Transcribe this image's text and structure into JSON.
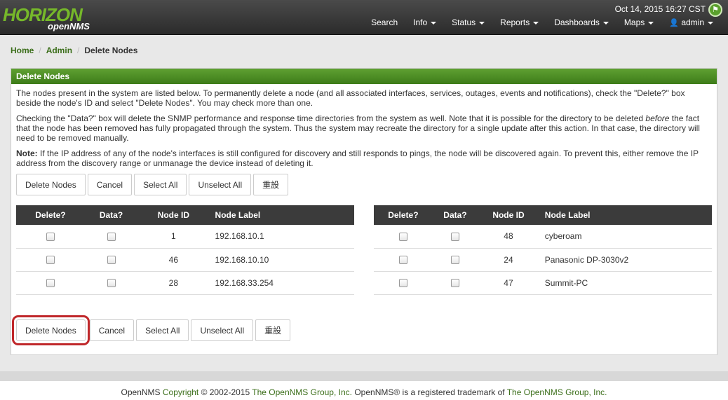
{
  "header": {
    "logo_horizon": "HORIZON",
    "logo_opennms": "openNMS",
    "datetime": "Oct 14, 2015 16:27 CST",
    "nav": [
      {
        "label": "Search",
        "dropdown": false
      },
      {
        "label": "Info",
        "dropdown": true
      },
      {
        "label": "Status",
        "dropdown": true
      },
      {
        "label": "Reports",
        "dropdown": true
      },
      {
        "label": "Dashboards",
        "dropdown": true
      },
      {
        "label": "Maps",
        "dropdown": true
      },
      {
        "label": "admin",
        "dropdown": true,
        "icon": "user-icon"
      }
    ]
  },
  "breadcrumb": {
    "home": "Home",
    "admin": "Admin",
    "current": "Delete Nodes"
  },
  "panel": {
    "title": "Delete Nodes",
    "p1": "The nodes present in the system are listed below. To permanently delete a node (and all associated interfaces, services, outages, events and notifications), check the \"Delete?\" box beside the node's ID and select \"Delete Nodes\". You may check more than one.",
    "p2a": "Checking the \"Data?\" box will delete the SNMP performance and response time directories from the system as well. Note that it is possible for the directory to be deleted ",
    "p2em": "before",
    "p2b": " the fact that the node has been removed has fully propagated through the system. Thus the system may recreate the directory for a single update after this action. In that case, the directory will need to be removed manually.",
    "p3label": "Note:",
    "p3": " If the IP address of any of the node's interfaces is still configured for discovery and still responds to pings, the node will be discovered again. To prevent this, either remove the IP address from the discovery range or unmanage the device instead of deleting it."
  },
  "buttons": {
    "delete": "Delete Nodes",
    "cancel": "Cancel",
    "select_all": "Select All",
    "unselect_all": "Unselect All",
    "reset": "重設"
  },
  "table_headers": {
    "delete": "Delete?",
    "data": "Data?",
    "node_id": "Node ID",
    "node_label": "Node Label"
  },
  "left_nodes": [
    {
      "id": "1",
      "label": "192.168.10.1"
    },
    {
      "id": "46",
      "label": "192.168.10.10"
    },
    {
      "id": "28",
      "label": "192.168.33.254"
    }
  ],
  "right_nodes": [
    {
      "id": "48",
      "label": "cyberoam"
    },
    {
      "id": "24",
      "label": "Panasonic DP-3030v2"
    },
    {
      "id": "47",
      "label": "Summit-PC"
    }
  ],
  "footer": {
    "t1": "OpenNMS ",
    "copyright": "Copyright",
    "t2": " © 2002-2015 ",
    "group1": "The OpenNMS Group, Inc.",
    "t3": " OpenNMS® is a registered trademark of ",
    "group2": "The OpenNMS Group, Inc."
  },
  "colors": {
    "brand_green": "#76b82a",
    "panel_heading": "#4d8f25",
    "highlight_red": "#c0282b"
  }
}
